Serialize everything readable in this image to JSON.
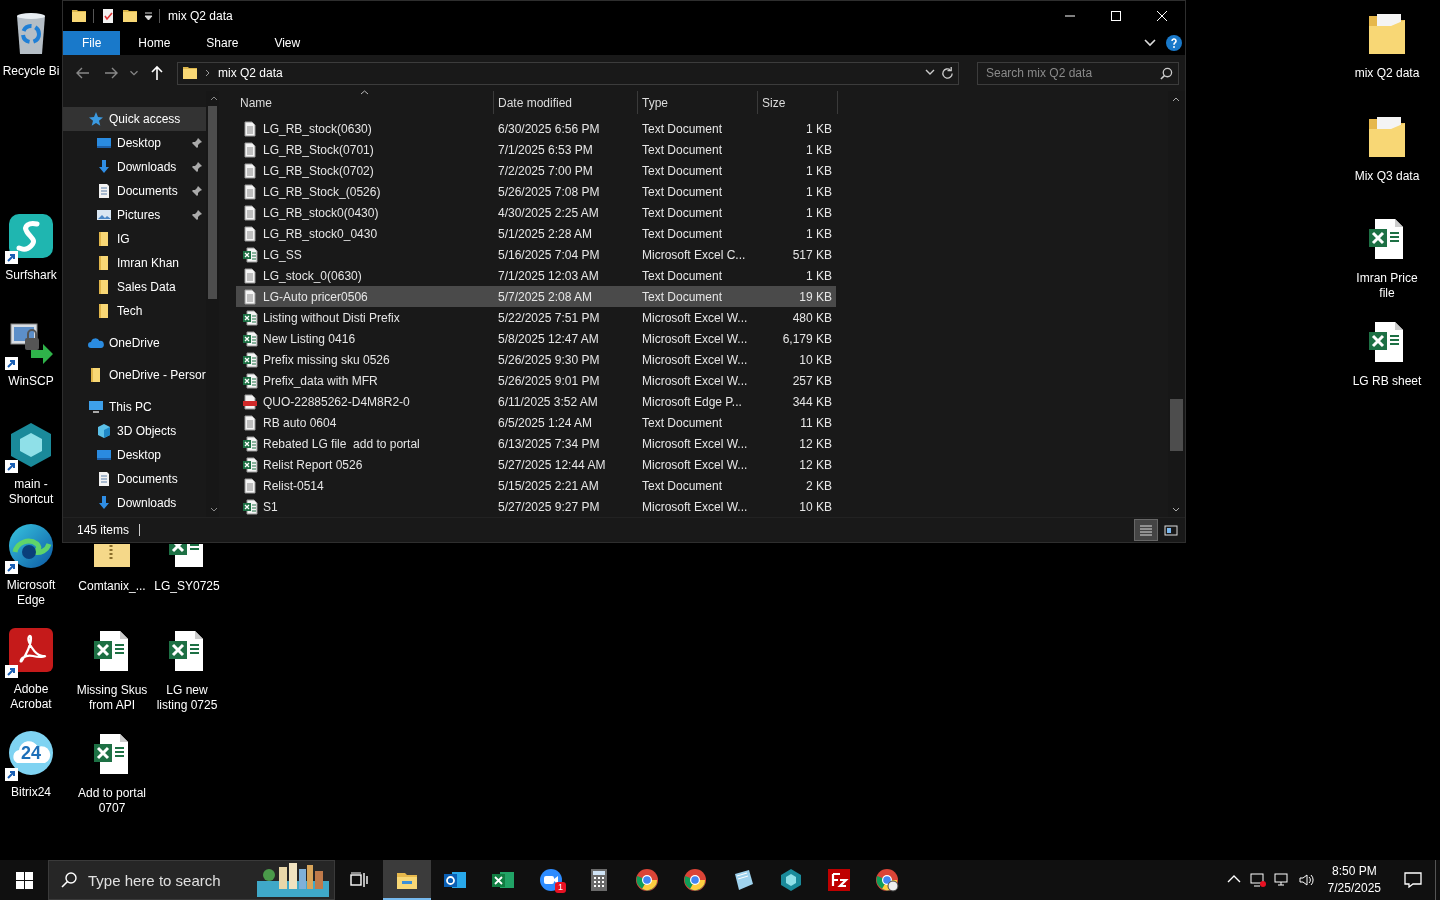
{
  "desktop_icons": [
    {
      "label": "Recycle Bi",
      "kind": "recycle",
      "shortcut": false
    },
    {
      "label": "Surfshark",
      "kind": "surfshark",
      "shortcut": true
    },
    {
      "label": "WinSCP",
      "kind": "winscp",
      "shortcut": true
    },
    {
      "label": "main - Shortcut",
      "kind": "diamond",
      "shortcut": true
    },
    {
      "label": "Microsoft Edge",
      "kind": "edge",
      "shortcut": true
    },
    {
      "label": "Adobe Acrobat",
      "kind": "acrobat",
      "shortcut": true
    },
    {
      "label": "Bitrix24",
      "kind": "bitrix",
      "shortcut": true,
      "logo_text": "24"
    },
    {
      "label": "Comtanix_...",
      "kind": "zip",
      "shortcut": false
    },
    {
      "label": "LG_SY0725",
      "kind": "excel",
      "shortcut": false
    },
    {
      "label": "Missing Skus from API",
      "kind": "excel",
      "shortcut": false
    },
    {
      "label": "LG new listing 0725",
      "kind": "excel",
      "shortcut": false
    },
    {
      "label": "Add to portal 0707",
      "kind": "excel",
      "shortcut": false
    },
    {
      "label": "mix Q2 data",
      "kind": "folder",
      "shortcut": false
    },
    {
      "label": "Mix Q3 data",
      "kind": "folder",
      "shortcut": false
    },
    {
      "label": "Imran Price file",
      "kind": "excel",
      "shortcut": false
    },
    {
      "label": "LG RB sheet",
      "kind": "excel",
      "shortcut": false
    }
  ],
  "window": {
    "title": "mix Q2 data",
    "ribbon_tabs": [
      {
        "label": "File",
        "selected": true
      },
      {
        "label": "Home",
        "selected": false
      },
      {
        "label": "Share",
        "selected": false
      },
      {
        "label": "View",
        "selected": false
      }
    ],
    "address": "mix Q2 data",
    "search": {
      "placeholder": "Search mix Q2 data"
    },
    "nav_pane": [
      {
        "label": "Quick access",
        "selected": true,
        "children": [
          {
            "label": "Desktop",
            "pinned": true,
            "selected": false
          },
          {
            "label": "Downloads",
            "pinned": true,
            "selected": false
          },
          {
            "label": "Documents",
            "pinned": true,
            "selected": false
          },
          {
            "label": "Pictures",
            "pinned": true,
            "selected": false
          },
          {
            "label": "IG",
            "pinned": false,
            "selected": false
          },
          {
            "label": "Imran Khan",
            "pinned": false,
            "selected": false
          },
          {
            "label": "Sales Data",
            "pinned": false,
            "selected": false
          },
          {
            "label": "Tech",
            "pinned": false,
            "selected": false
          }
        ]
      },
      {
        "label": "OneDrive",
        "selected": false
      },
      {
        "label": "OneDrive - Persor",
        "selected": false
      },
      {
        "label": "This PC",
        "selected": false,
        "children": [
          {
            "label": "3D Objects",
            "pinned": false,
            "selected": false
          },
          {
            "label": "Desktop",
            "pinned": false,
            "selected": false
          },
          {
            "label": "Documents",
            "pinned": false,
            "selected": false
          },
          {
            "label": "Downloads",
            "pinned": false,
            "selected": false
          }
        ]
      }
    ],
    "columns": [
      "Name",
      "Date modified",
      "Type",
      "Size"
    ],
    "rows": [
      {
        "name": "LG_RB_stock(0630)",
        "date": "6/30/2025 6:56 PM",
        "type": "Text Document",
        "size": "1 KB",
        "kind": "text",
        "selected": false
      },
      {
        "name": "LG_RB_Stock(0701)",
        "date": "7/1/2025 6:53 PM",
        "type": "Text Document",
        "size": "1 KB",
        "kind": "text",
        "selected": false
      },
      {
        "name": "LG_RB_Stock(0702)",
        "date": "7/2/2025 7:00 PM",
        "type": "Text Document",
        "size": "1 KB",
        "kind": "text",
        "selected": false
      },
      {
        "name": "LG_RB_Stock_(0526)",
        "date": "5/26/2025 7:08 PM",
        "type": "Text Document",
        "size": "1 KB",
        "kind": "text",
        "selected": false
      },
      {
        "name": "LG_RB_stock0(0430)",
        "date": "4/30/2025 2:25 AM",
        "type": "Text Document",
        "size": "1 KB",
        "kind": "text",
        "selected": false
      },
      {
        "name": "LG_RB_stock0_0430",
        "date": "5/1/2025 2:28 AM",
        "type": "Text Document",
        "size": "1 KB",
        "kind": "text",
        "selected": false
      },
      {
        "name": "LG_SS",
        "date": "5/16/2025 7:04 PM",
        "type": "Microsoft Excel C...",
        "size": "517 KB",
        "kind": "excel",
        "selected": false
      },
      {
        "name": "LG_stock_0(0630)",
        "date": "7/1/2025 12:03 AM",
        "type": "Text Document",
        "size": "1 KB",
        "kind": "text",
        "selected": false
      },
      {
        "name": "LG-Auto pricer0506",
        "date": "5/7/2025 2:08 AM",
        "type": "Text Document",
        "size": "19 KB",
        "kind": "text",
        "selected": true
      },
      {
        "name": "Listing without Disti Prefix",
        "date": "5/22/2025 7:51 PM",
        "type": "Microsoft Excel W...",
        "size": "480 KB",
        "kind": "excel",
        "selected": false
      },
      {
        "name": "New Listing 0416",
        "date": "5/8/2025 12:47 AM",
        "type": "Microsoft Excel W...",
        "size": "6,179 KB",
        "kind": "excel",
        "selected": false
      },
      {
        "name": "Prefix missing sku 0526",
        "date": "5/26/2025 9:30 PM",
        "type": "Microsoft Excel W...",
        "size": "10 KB",
        "kind": "excel",
        "selected": false
      },
      {
        "name": "Prefix_data with MFR",
        "date": "5/26/2025 9:01 PM",
        "type": "Microsoft Excel W...",
        "size": "257 KB",
        "kind": "excel",
        "selected": false
      },
      {
        "name": "QUO-22885262-D4M8R2-0",
        "date": "6/11/2025 3:52 AM",
        "type": "Microsoft Edge P...",
        "size": "344 KB",
        "kind": "pdf",
        "selected": false
      },
      {
        "name": "RB auto 0604",
        "date": "6/5/2025 1:24 AM",
        "type": "Text Document",
        "size": "11 KB",
        "kind": "text",
        "selected": false
      },
      {
        "name": "Rebated LG file  add to portal",
        "date": "6/13/2025 7:34 PM",
        "type": "Microsoft Excel W...",
        "size": "12 KB",
        "kind": "excel",
        "selected": false
      },
      {
        "name": "Relist Report 0526",
        "date": "5/27/2025 12:44 AM",
        "type": "Microsoft Excel W...",
        "size": "12 KB",
        "kind": "excel",
        "selected": false
      },
      {
        "name": "Relist-0514",
        "date": "5/15/2025 2:21 AM",
        "type": "Text Document",
        "size": "2 KB",
        "kind": "text",
        "selected": false
      },
      {
        "name": "S1",
        "date": "5/27/2025 9:27 PM",
        "type": "Microsoft Excel W...",
        "size": "10 KB",
        "kind": "excel",
        "selected": false
      }
    ],
    "status": "145 items",
    "view_buttons": [
      {
        "kind": "details",
        "selected": true
      },
      {
        "kind": "tiles",
        "selected": false
      }
    ]
  },
  "taskbar": {
    "search": {
      "placeholder": "Type here to search"
    },
    "apps": [
      {
        "kind": "explorer",
        "active": true
      },
      {
        "kind": "outlook",
        "active": false
      },
      {
        "kind": "excel",
        "active": false
      },
      {
        "kind": "zoom",
        "active": false,
        "badge": "1"
      },
      {
        "kind": "calculator",
        "active": false
      },
      {
        "kind": "chrome",
        "active": false
      },
      {
        "kind": "chrome",
        "active": false
      },
      {
        "kind": "paper",
        "active": false
      },
      {
        "kind": "diamond",
        "active": false
      },
      {
        "kind": "filezilla",
        "active": false
      },
      {
        "kind": "chrome-profile",
        "active": false
      }
    ],
    "time": "8:50 PM",
    "date": "7/25/2025"
  }
}
